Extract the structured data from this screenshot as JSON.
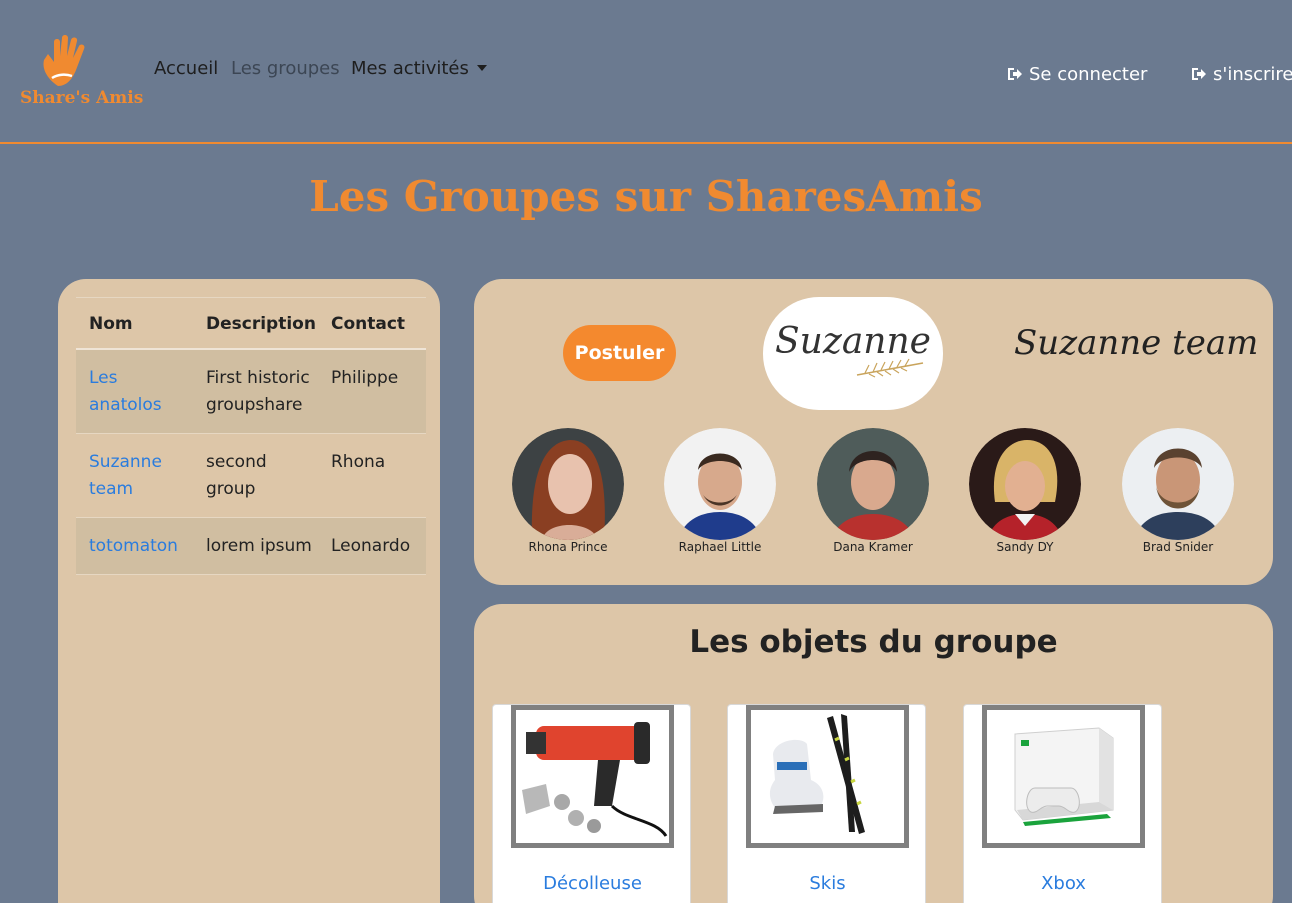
{
  "brand": {
    "name": "Share's Amis",
    "accent": "#f08a30"
  },
  "nav": {
    "home": "Accueil",
    "groups": "Les groupes",
    "activities": "Mes activités",
    "login": "Se connecter",
    "register": "s'inscrire"
  },
  "page_title": "Les Groupes sur SharesAmis",
  "groups_table": {
    "headers": [
      "Nom",
      "Description",
      "Contact"
    ],
    "rows": [
      {
        "name": "Les anatolos",
        "description": "First historic groupshare",
        "contact": "Philippe"
      },
      {
        "name": "Suzanne team",
        "description": "second group",
        "contact": "Rhona"
      },
      {
        "name": "totomaton",
        "description": "lorem ipsum",
        "contact": "Leonardo"
      }
    ]
  },
  "group": {
    "apply_label": "Postuler",
    "logo_text": "Suzanne",
    "team_name": "Suzanne team",
    "members": [
      {
        "name": "Rhona Prince"
      },
      {
        "name": "Raphael Little"
      },
      {
        "name": "Dana Kramer"
      },
      {
        "name": "Sandy DY"
      },
      {
        "name": "Brad Snider"
      }
    ]
  },
  "objects": {
    "title": "Les objets du groupe",
    "items": [
      {
        "label": "Décolleuse",
        "icon": "heat-gun-image"
      },
      {
        "label": "Skis",
        "icon": "skis-image"
      },
      {
        "label": "Xbox",
        "icon": "xbox-image"
      }
    ]
  }
}
